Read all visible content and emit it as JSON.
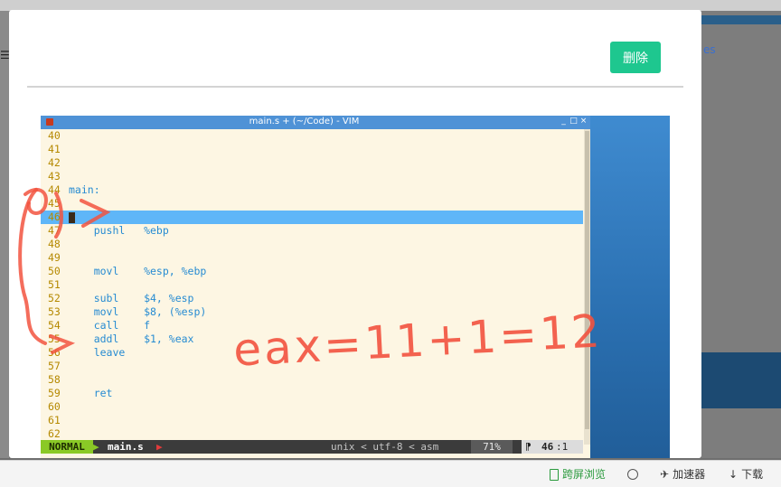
{
  "modal": {
    "delete_label": "删除"
  },
  "vim": {
    "title": "main.s + (~/Code) - VIM",
    "window_controls": [
      "_",
      "□",
      "×"
    ],
    "lines": [
      {
        "num": "40",
        "text": ""
      },
      {
        "num": "41",
        "text": ""
      },
      {
        "num": "42",
        "text": ""
      },
      {
        "num": "43",
        "text": ""
      },
      {
        "num": "44",
        "text": "main:"
      },
      {
        "num": "45",
        "text": ""
      },
      {
        "num": "46",
        "text": "",
        "current": true
      },
      {
        "num": "47",
        "text": "    pushl   %ebp"
      },
      {
        "num": "48",
        "text": ""
      },
      {
        "num": "49",
        "text": ""
      },
      {
        "num": "50",
        "text": "    movl    %esp, %ebp"
      },
      {
        "num": "51",
        "text": ""
      },
      {
        "num": "52",
        "text": "    subl    $4, %esp"
      },
      {
        "num": "53",
        "text": "    movl    $8, (%esp)"
      },
      {
        "num": "54",
        "text": "    call    f"
      },
      {
        "num": "55",
        "text": "    addl    $1, %eax"
      },
      {
        "num": "56",
        "text": "    leave"
      },
      {
        "num": "57",
        "text": ""
      },
      {
        "num": "58",
        "text": ""
      },
      {
        "num": "59",
        "text": "    ret"
      },
      {
        "num": "60",
        "text": ""
      },
      {
        "num": "61",
        "text": ""
      },
      {
        "num": "62",
        "text": ""
      }
    ],
    "status": {
      "mode": "NORMAL",
      "file": "main.s",
      "encoding": "unix < utf-8 < asm",
      "percent": "71%",
      "position_line": "46",
      "position_col": ":1"
    }
  },
  "annotation": {
    "handwritten": "eax=11+1=12"
  },
  "background": {
    "right_link": "es"
  },
  "bottombar": {
    "screen_browse": "跨屏浏览",
    "accelerator": "加速器",
    "download": "下载"
  },
  "colors": {
    "delete_button": "#1ec78f",
    "vim_title": "#4f92d6",
    "current_line": "#5fb6f8",
    "annotation": "#f2533f",
    "mode_normal": "#8ac926"
  }
}
